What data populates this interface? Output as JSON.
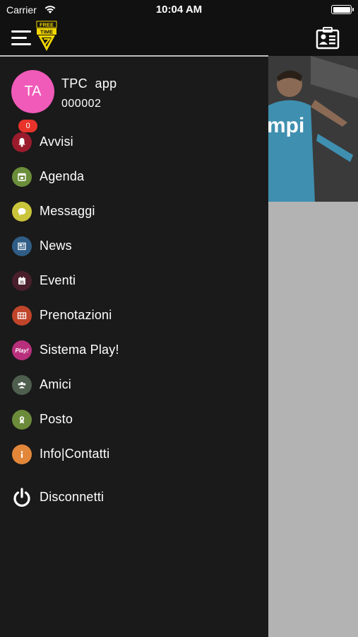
{
  "status_bar": {
    "carrier": "Carrier",
    "time": "10:04 AM"
  },
  "nav": {
    "logo_top": "FREE",
    "logo_bottom": "TIME"
  },
  "hero": {
    "text": "mpi"
  },
  "user": {
    "initials": "TA",
    "name": "TPC  app",
    "id": "000002",
    "avatar_color": "#f05ab8"
  },
  "menu": {
    "items": [
      {
        "label": "Avvisi",
        "icon": "bell-icon",
        "color": "#9a1c2c",
        "badge": "0"
      },
      {
        "label": "Agenda",
        "icon": "calendar-icon",
        "color": "#6b8e3a"
      },
      {
        "label": "Messaggi",
        "icon": "chat-bubble-icon",
        "color": "#c9c43a"
      },
      {
        "label": "News",
        "icon": "newspaper-icon",
        "color": "#2f5d86"
      },
      {
        "label": "Eventi",
        "icon": "event-calendar-icon",
        "color": "#4a1f2c"
      },
      {
        "label": "Prenotazioni",
        "icon": "booking-grid-icon",
        "color": "#c0452a"
      },
      {
        "label": "Sistema Play!",
        "icon": "play-logo-icon",
        "color": "#b8307c",
        "icon_text": "Play!"
      },
      {
        "label": "Amici",
        "icon": "friends-icon",
        "color": "#4f5f4f"
      },
      {
        "label": "Posto",
        "icon": "seat-medal-icon",
        "color": "#6b8a3a"
      },
      {
        "label": "Info|Contatti",
        "icon": "info-icon",
        "color": "#e2873a"
      }
    ],
    "logout": {
      "label": "Disconnetti",
      "icon": "power-icon"
    }
  },
  "colors": {
    "drawer_bg": "#1a1a1a",
    "nav_bg": "#111111",
    "content_bg": "#b3b3b3",
    "badge": "#e8342b"
  }
}
